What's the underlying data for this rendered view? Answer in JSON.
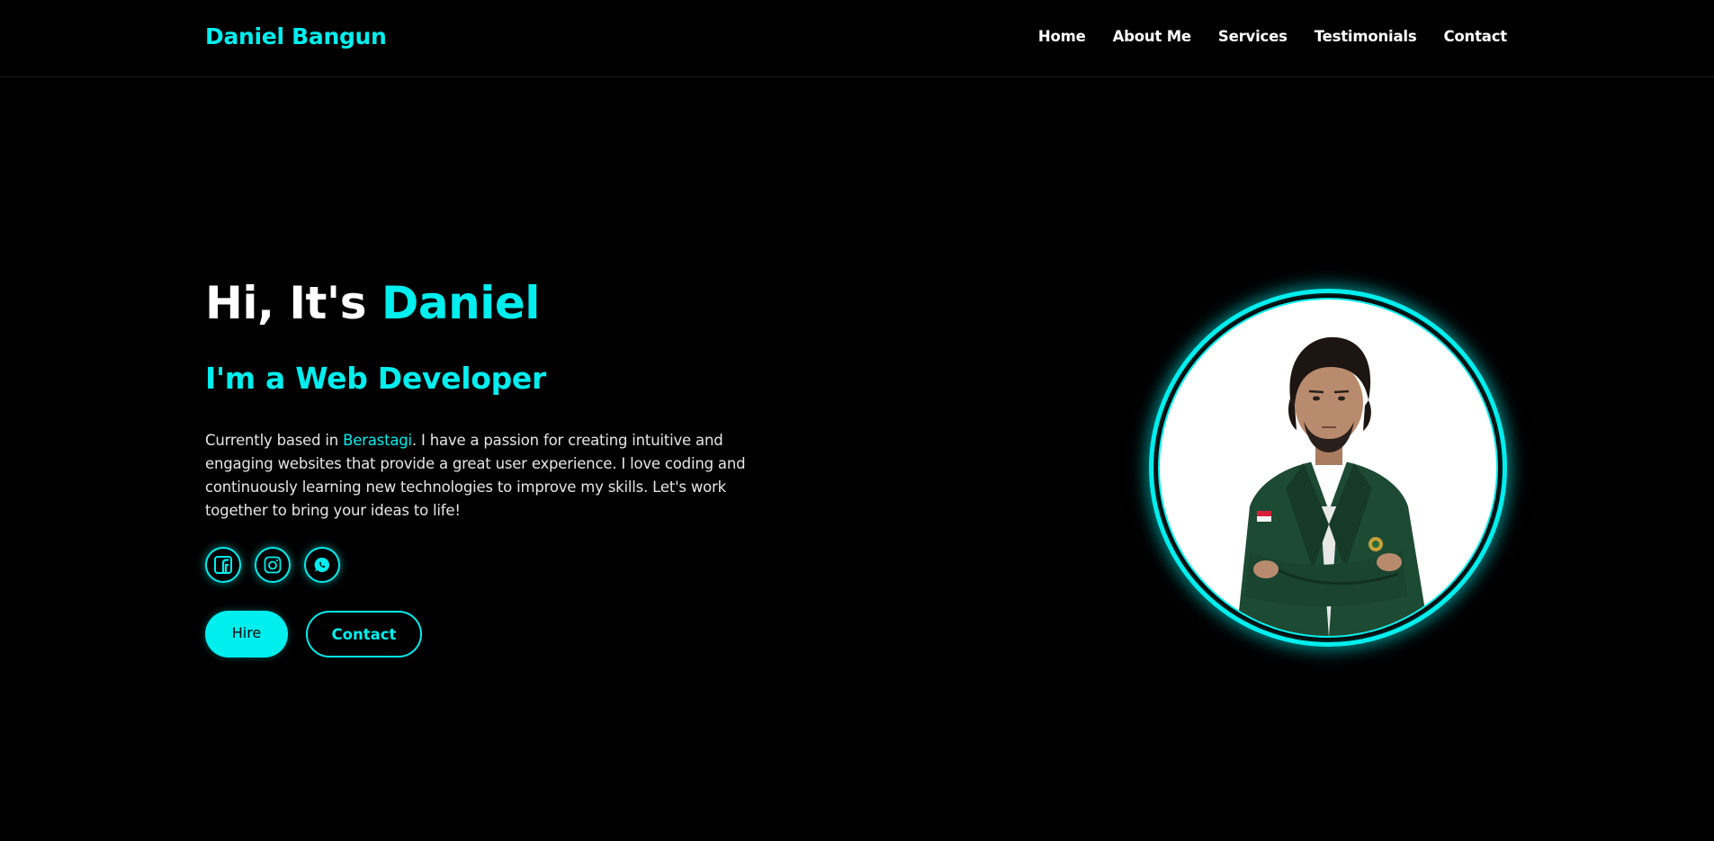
{
  "header": {
    "logo": "Daniel Bangun",
    "nav": [
      "Home",
      "About Me",
      "Services",
      "Testimonials",
      "Contact"
    ]
  },
  "hero": {
    "greeting_prefix": "Hi, It's",
    "greeting_name": "Daniel",
    "role": "I'm a Web Developer",
    "desc_before": "Currently based in ",
    "desc_city": "Berastagi",
    "desc_after": ". I have a passion for creating intuitive and engaging websites that provide a great user experience. I love coding and continuously learning new technologies to improve my skills. Let's work together to bring your ideas to life!",
    "socials": [
      {
        "icon": "facebook-icon"
      },
      {
        "icon": "instagram-icon"
      },
      {
        "icon": "whatsapp-icon"
      }
    ],
    "hire_label": "Hire",
    "contact_label": "Contact"
  },
  "profile": {
    "image": "profile-photo"
  },
  "colors": {
    "accent": "#00eeee",
    "background": "#000000",
    "text": "#ffffff"
  }
}
